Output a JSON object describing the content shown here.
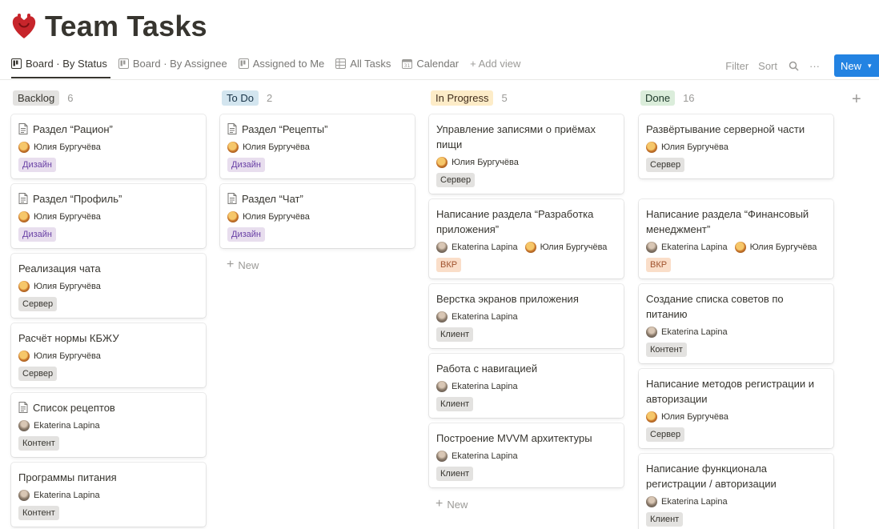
{
  "page": {
    "title": "Team Tasks",
    "icon": "heart-organ-icon"
  },
  "views": [
    {
      "label": "Board · By Status",
      "icon": "board-icon",
      "active": true
    },
    {
      "label": "Board · By Assignee",
      "icon": "board-icon"
    },
    {
      "label": "Assigned to Me",
      "icon": "board-icon"
    },
    {
      "label": "All Tasks",
      "icon": "table-icon"
    },
    {
      "label": "Calendar",
      "icon": "calendar-icon"
    },
    {
      "label": "+ Add view",
      "icon": "plus-icon"
    }
  ],
  "toolbar": {
    "filter": "Filter",
    "sort": "Sort",
    "search_icon": "search-icon",
    "more": "···",
    "new": "New"
  },
  "colors": {
    "accent": "#2383e2",
    "backlog_bg": "#e3e2e0",
    "todo_bg": "#d3e5ef",
    "inprogress_bg": "#fdecc8",
    "done_bg": "#dbeddb"
  },
  "columns": [
    {
      "name": "Backlog",
      "count": "6",
      "cards": [
        {
          "title": "Раздел “Рацион”",
          "doc": true,
          "people": [
            "Юлия Бургучёва"
          ],
          "tag": "Дизайн"
        },
        {
          "title": "Раздел “Профиль”",
          "doc": true,
          "people": [
            "Юлия Бургучёва"
          ],
          "tag": "Дизайн"
        },
        {
          "title": "Реализация чата",
          "doc": false,
          "people": [
            "Юлия Бургучёва"
          ],
          "tag": "Сервер"
        },
        {
          "title": "Расчёт нормы КБЖУ",
          "doc": false,
          "people": [
            "Юлия Бургучёва"
          ],
          "tag": "Сервер"
        },
        {
          "title": "Список рецептов",
          "doc": true,
          "people": [
            "Ekaterina Lapina"
          ],
          "tag": "Контент"
        },
        {
          "title": "Программы питания",
          "doc": false,
          "people": [
            "Ekaterina Lapina"
          ],
          "tag": "Контент"
        }
      ]
    },
    {
      "name": "To Do",
      "count": "2",
      "cards": [
        {
          "title": "Раздел “Рецепты”",
          "doc": true,
          "people": [
            "Юлия Бургучёва"
          ],
          "tag": "Дизайн"
        },
        {
          "title": "Раздел “Чат”",
          "doc": true,
          "people": [
            "Юлия Бургучёва"
          ],
          "tag": "Дизайн"
        }
      ],
      "new_label": "New"
    },
    {
      "name": "In Progress",
      "count": "5",
      "cards": [
        {
          "title": "Управление записями о приёмах пищи",
          "doc": false,
          "people": [
            "Юлия Бургучёва"
          ],
          "tag": "Сервер"
        },
        {
          "title": "Написание раздела “Разработка приложения”",
          "doc": false,
          "people": [
            "Ekaterina Lapina",
            "Юлия Бургучёва"
          ],
          "tag": "ВКР"
        },
        {
          "title": "Верстка экранов приложения",
          "doc": false,
          "people": [
            "Ekaterina Lapina"
          ],
          "tag": "Клиент"
        },
        {
          "title": "Работа с навигацией",
          "doc": false,
          "people": [
            "Ekaterina Lapina"
          ],
          "tag": "Клиент"
        },
        {
          "title": "Построение MVVM архитектуры",
          "doc": false,
          "people": [
            "Ekaterina Lapina"
          ],
          "tag": "Клиент"
        }
      ],
      "new_label": "New"
    },
    {
      "name": "Done",
      "count": "16",
      "cards": [
        {
          "title": "Развёртывание серверной части",
          "doc": false,
          "people": [
            "Юлия Бургучёва"
          ],
          "tag": "Сервер"
        },
        {
          "title": "Написание раздела “Финансовый менеджмент”",
          "doc": false,
          "people": [
            "Ekaterina Lapina",
            "Юлия Бургучёва"
          ],
          "tag": "ВКР"
        },
        {
          "title": "Создание списка советов по питанию",
          "doc": false,
          "people": [
            "Ekaterina Lapina"
          ],
          "tag": "Контент"
        },
        {
          "title": "Написание методов регистрации и авторизации",
          "doc": false,
          "people": [
            "Юлия Бургучёва"
          ],
          "tag": "Сервер"
        },
        {
          "title": "Написание функционала регистрации / авторизации",
          "doc": false,
          "people": [
            "Ekaterina Lapina"
          ],
          "tag": "Клиент"
        }
      ]
    }
  ]
}
